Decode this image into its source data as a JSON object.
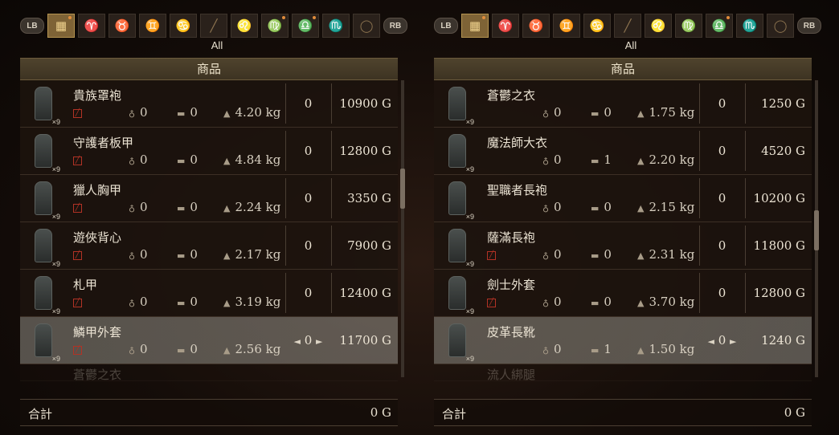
{
  "left": {
    "lb_label": "LB",
    "rb_label": "RB",
    "filter_label": "All",
    "header_label": "商品",
    "items": [
      {
        "name": "貴族罩袍",
        "qty": "×9",
        "stat1": "0",
        "stat2": "0",
        "weight": "4.20 kg",
        "count": "0",
        "price": "10900 G"
      },
      {
        "name": "守護者板甲",
        "qty": "×9",
        "stat1": "0",
        "stat2": "0",
        "weight": "4.84 kg",
        "count": "0",
        "price": "12800 G"
      },
      {
        "name": "獵人胸甲",
        "qty": "×9",
        "stat1": "0",
        "stat2": "0",
        "weight": "2.24 kg",
        "count": "0",
        "price": "3350 G"
      },
      {
        "name": "遊俠背心",
        "qty": "×9",
        "stat1": "0",
        "stat2": "0",
        "weight": "2.17 kg",
        "count": "0",
        "price": "7900 G"
      },
      {
        "name": "札甲",
        "qty": "×9",
        "stat1": "0",
        "stat2": "0",
        "weight": "3.19 kg",
        "count": "0",
        "price": "12400 G"
      },
      {
        "name": "鱗甲外套",
        "qty": "×9",
        "stat1": "0",
        "stat2": "0",
        "weight": "2.56 kg",
        "count": "0",
        "price": "11700 G"
      }
    ],
    "partial_item": "蒼鬱之衣",
    "total_label": "合計",
    "total_value": "0 G"
  },
  "right": {
    "lb_label": "LB",
    "rb_label": "RB",
    "filter_label": "All",
    "header_label": "商品",
    "items": [
      {
        "name": "蒼鬱之衣",
        "qty": "×9",
        "stat1": "0",
        "stat2": "0",
        "weight": "1.75 kg",
        "count": "0",
        "price": "1250 G"
      },
      {
        "name": "魔法師大衣",
        "qty": "×9",
        "stat1": "0",
        "stat2": "1",
        "weight": "2.20 kg",
        "count": "0",
        "price": "4520 G"
      },
      {
        "name": "聖職者長袍",
        "qty": "×9",
        "stat1": "0",
        "stat2": "0",
        "weight": "2.15 kg",
        "count": "0",
        "price": "10200 G"
      },
      {
        "name": "薩滿長袍",
        "qty": "×9",
        "stat1": "0",
        "stat2": "0",
        "weight": "2.31 kg",
        "count": "0",
        "price": "11800 G"
      },
      {
        "name": "劍士外套",
        "qty": "×9",
        "stat1": "0",
        "stat2": "0",
        "weight": "3.70 kg",
        "count": "0",
        "price": "12800 G"
      },
      {
        "name": "皮革長靴",
        "qty": "×9",
        "stat1": "0",
        "stat2": "1",
        "weight": "1.50 kg",
        "count": "0",
        "price": "1240 G"
      }
    ],
    "partial_item": "流人綁腿",
    "total_label": "合計",
    "total_value": "0 G"
  },
  "arrow_left": "◄",
  "arrow_right": "►"
}
